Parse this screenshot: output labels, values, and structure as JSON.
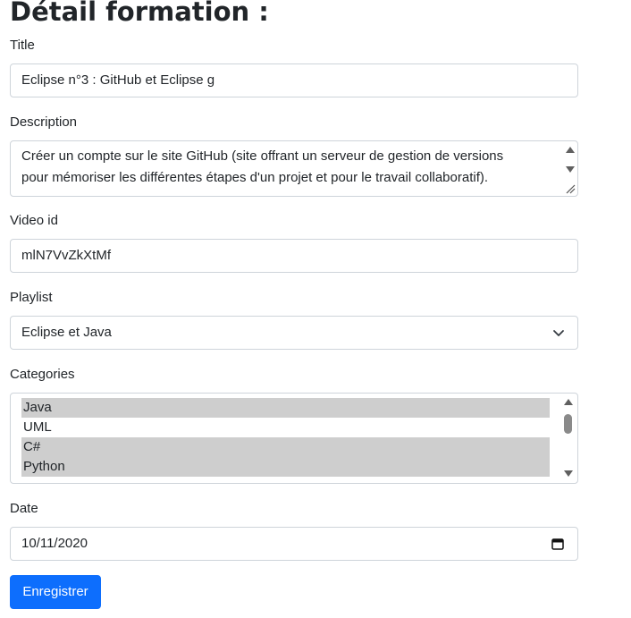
{
  "page": {
    "title": "Détail formation :"
  },
  "form": {
    "title_label": "Title",
    "title_value": "Eclipse n°3 : GitHub et Eclipse g",
    "description_label": "Description",
    "description_line1": "Créer un compte sur le site GitHub (site offrant un serveur de gestion de versions",
    "description_line2": "pour mémoriser les différentes étapes d'un projet et pour le travail collaboratif).",
    "video_label": "Video id",
    "video_value": "mlN7VvZkXtMf",
    "playlist_label": "Playlist",
    "playlist_value": "Eclipse et Java",
    "categories_label": "Categories",
    "categories": [
      {
        "label": "Java",
        "selected": true
      },
      {
        "label": "UML",
        "selected": false
      },
      {
        "label": "C#",
        "selected": true
      },
      {
        "label": "Python",
        "selected": true
      }
    ],
    "date_label": "Date",
    "date_value": "10/11/2020",
    "submit_label": "Enregistrer"
  },
  "icons": {
    "playlist": "chevron-down-icon",
    "date": "calendar-icon",
    "scroll": "scroll-arrow-icon"
  },
  "colors": {
    "accent": "#0d6efd",
    "selected_option": "#cecece",
    "border": "#ced4da"
  }
}
